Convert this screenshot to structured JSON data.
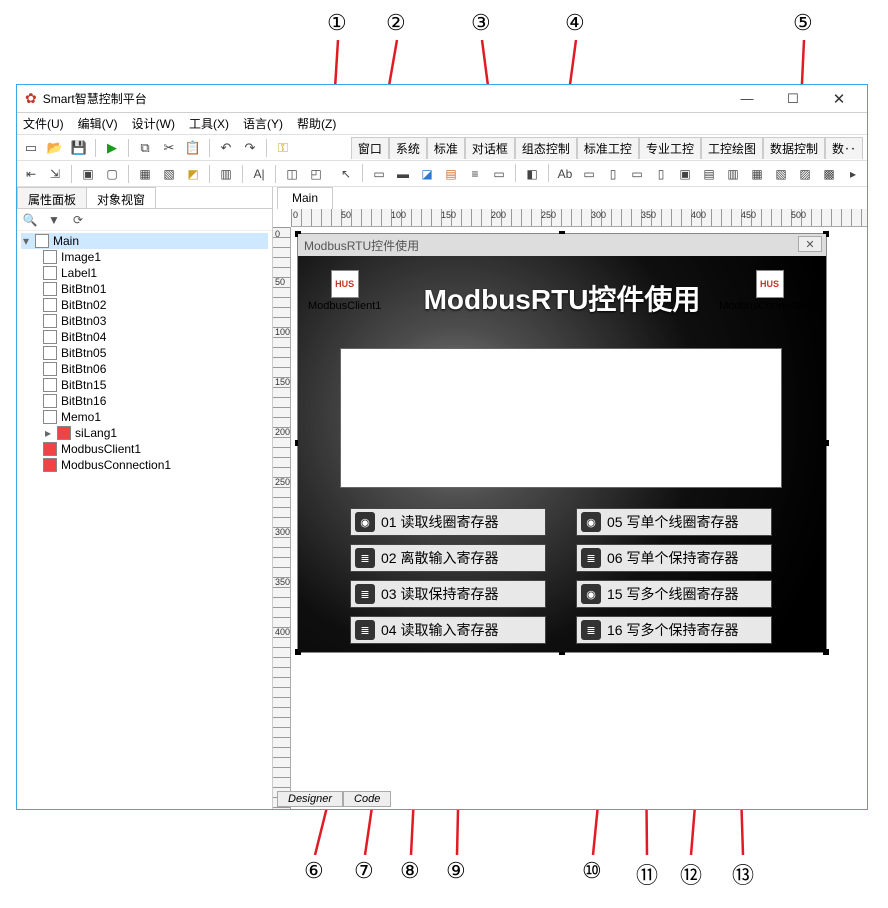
{
  "callouts_top": [
    "①",
    "②",
    "③",
    "④",
    "⑤"
  ],
  "callouts_bottom": [
    "⑥",
    "⑦",
    "⑧",
    "⑨",
    "⑩",
    "⑪",
    "⑫",
    "⑬"
  ],
  "window": {
    "title": "Smart智慧控制平台",
    "min": "—",
    "max": "☐",
    "close": "✕"
  },
  "menu": [
    "文件(U)",
    "编辑(V)",
    "设计(W)",
    "工具(X)",
    "语言(Y)",
    "帮助(Z)"
  ],
  "category_tabs": [
    "窗口",
    "系统",
    "标准",
    "对话框",
    "组态控制",
    "标准工控",
    "专业工控",
    "工控绘图",
    "数据控制",
    "数‥"
  ],
  "left_tabs": {
    "tab1": "属性面板",
    "tab2": "对象视窗"
  },
  "tree": {
    "root": "Main",
    "children": [
      "Image1",
      "Label1",
      "BitBtn01",
      "BitBtn02",
      "BitBtn03",
      "BitBtn04",
      "BitBtn05",
      "BitBtn06",
      "BitBtn15",
      "BitBtn16",
      "Memo1",
      "siLang1",
      "ModbusClient1",
      "ModbusConnection1"
    ]
  },
  "main_tab": "Main",
  "ruler_h": [
    "0",
    "50",
    "100",
    "150",
    "200",
    "250",
    "300",
    "350",
    "400",
    "450",
    "500"
  ],
  "ruler_v": [
    "0",
    "50",
    "100",
    "150",
    "200",
    "250",
    "300",
    "350",
    "400"
  ],
  "form": {
    "title": "ModbusRTU控件使用",
    "big_title": "ModbusRTU控件使用",
    "close": "✕",
    "comp1_icon": "HUS",
    "comp1_label": "ModbusClient1",
    "comp2_icon": "HUS",
    "comp2_label": "ModbusConnection1",
    "buttons_left": [
      "01 读取线圈寄存器",
      "02 离散输入寄存器",
      "03 读取保持寄存器",
      "04 读取输入寄存器"
    ],
    "buttons_right": [
      "05 写单个线圈寄存器",
      "06 写单个保持寄存器",
      "15 写多个线圈寄存器",
      "16 写多个保持寄存器"
    ]
  },
  "bottom_tabs": {
    "t1": "Designer",
    "t2": "Code"
  }
}
